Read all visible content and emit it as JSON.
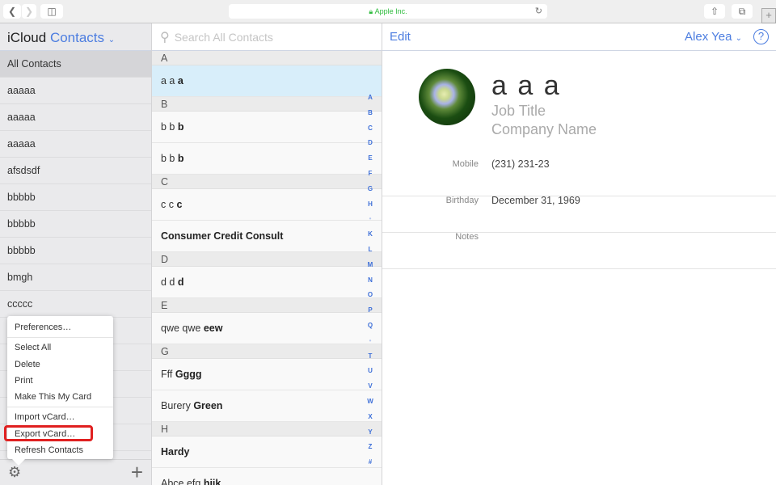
{
  "browser": {
    "url": "Apple Inc.",
    "back_icon": "chevron-left",
    "forward_icon": "chevron-right"
  },
  "sidebar": {
    "brand": "iCloud",
    "app": "Contacts",
    "groups": [
      "All Contacts",
      "aaaaa",
      "aaaaa",
      "aaaaa",
      "afsdsdf",
      "bbbbb",
      "bbbbb",
      "bbbbb",
      "bmgh",
      "ccccc",
      "",
      "",
      "",
      "",
      ""
    ]
  },
  "menu": {
    "items": [
      [
        "Preferences…"
      ],
      [
        "Select All",
        "Delete",
        "Print",
        "Make This My Card"
      ],
      [
        "Import vCard…",
        "Export vCard…",
        "Refresh Contacts"
      ]
    ],
    "highlighted": "Export vCard…",
    "highlight_color": "#e02020"
  },
  "list": {
    "search_placeholder": "Search All Contacts",
    "sections": [
      {
        "letter": "A",
        "rows": [
          {
            "first": "a a",
            "last": "a",
            "selected": true
          }
        ]
      },
      {
        "letter": "B",
        "rows": [
          {
            "first": "b b",
            "last": "b"
          },
          {
            "first": "b b",
            "last": "b"
          }
        ]
      },
      {
        "letter": "C",
        "rows": [
          {
            "first": "c c",
            "last": "c"
          },
          {
            "first": "",
            "last": "Consumer Credit Consult"
          }
        ]
      },
      {
        "letter": "D",
        "rows": [
          {
            "first": "d d",
            "last": "d"
          }
        ]
      },
      {
        "letter": "E",
        "rows": [
          {
            "first": "qwe qwe",
            "last": "eew"
          }
        ]
      },
      {
        "letter": "G",
        "rows": [
          {
            "first": "Fff",
            "last": "Gggg"
          },
          {
            "first": "Burery",
            "last": "Green"
          }
        ]
      },
      {
        "letter": "H",
        "rows": [
          {
            "first": "",
            "last": "Hardy"
          },
          {
            "first": "Abce efg",
            "last": "hijk"
          }
        ]
      }
    ],
    "index": [
      "A",
      "B",
      "C",
      "D",
      "E",
      "F",
      "G",
      "H",
      "•",
      "K",
      "L",
      "M",
      "N",
      "O",
      "P",
      "Q",
      "•",
      "T",
      "U",
      "V",
      "W",
      "X",
      "Y",
      "Z",
      "#"
    ]
  },
  "detail": {
    "edit": "Edit",
    "user": "Alex Yea",
    "help": "?",
    "name": "a a a",
    "job_title": "Job Title",
    "company": "Company Name",
    "fields": [
      {
        "label": "Mobile",
        "value": "(231) 231-23"
      },
      {
        "label": "Birthday",
        "value": "December 31, 1969"
      },
      {
        "label": "Notes",
        "value": ""
      }
    ]
  }
}
